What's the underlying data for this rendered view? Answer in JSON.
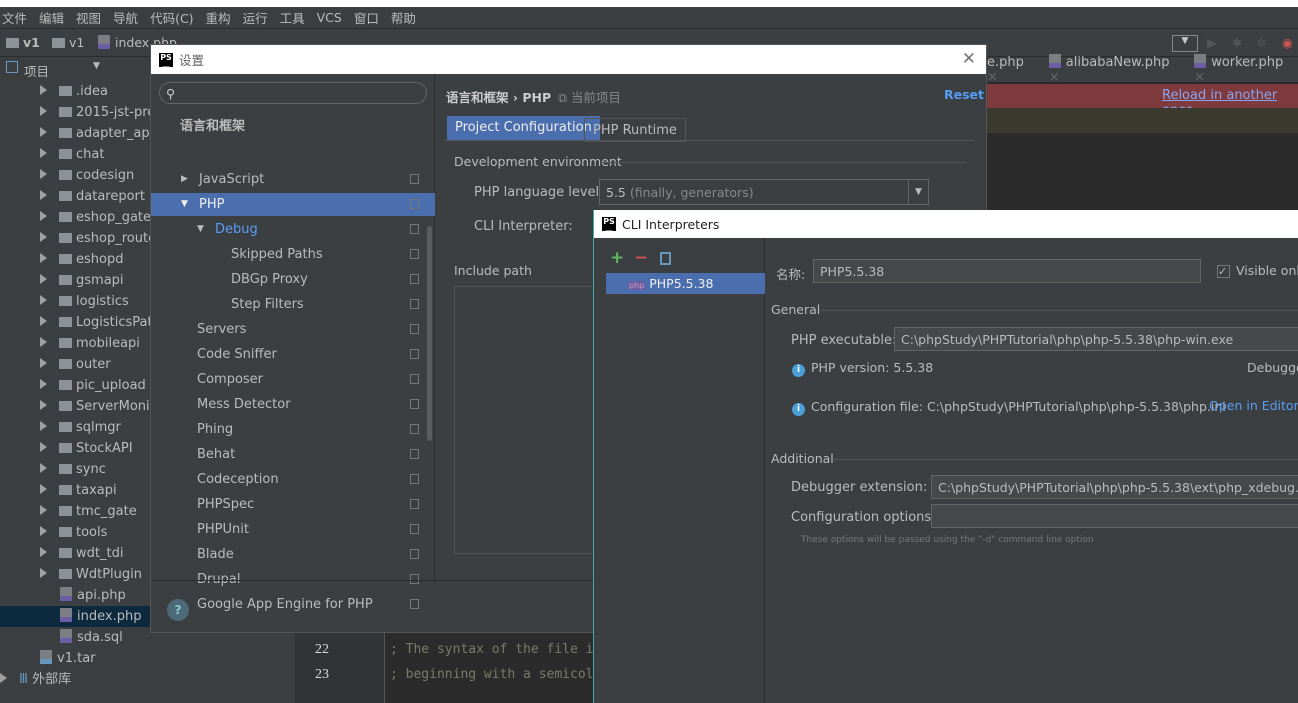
{
  "menu": [
    "文件",
    "编辑",
    "视图",
    "导航",
    "代码(C)",
    "重构",
    "运行",
    "工具",
    "VCS",
    "窗口",
    "帮助"
  ],
  "breadcrumb": [
    "v1",
    "v1",
    "index.php"
  ],
  "project_panel": {
    "title": "项目"
  },
  "tree": {
    "folders": [
      ".idea",
      "2015-jst-pre",
      "adapter_api",
      "chat",
      "codesign",
      "datareport",
      "eshop_gate",
      "eshop_route",
      "eshopd",
      "gsmapi",
      "logistics",
      "LogisticsPath",
      "mobileapi",
      "outer",
      "pic_upload",
      "ServerMonito",
      "sqlmgr",
      "StockAPI",
      "sync",
      "taxapi",
      "tmc_gate",
      "tools",
      "wdt_tdi",
      "WdtPlugin"
    ],
    "files": [
      "api.php",
      "index.php",
      "sda.sql"
    ],
    "selected": "index.php",
    "archive": "v1.tar",
    "external": "外部库"
  },
  "editor": {
    "tabs": [
      "e.php",
      "alibabaNew.php",
      "worker.php"
    ],
    "banner_link": "Reload in another enco",
    "lines": [
      {
        "num": "22",
        "text": "; The syntax of the file i"
      },
      {
        "num": "23",
        "text": "; beginning with a semicol"
      }
    ]
  },
  "settings": {
    "title": "设置",
    "search_placeholder": "",
    "section": "语言和框架",
    "items": [
      {
        "label": "JavaScript",
        "level": 0,
        "arrow": "collapsed"
      },
      {
        "label": "PHP",
        "level": 0,
        "arrow": "expanded",
        "selected": true
      },
      {
        "label": "Debug",
        "level": 1,
        "arrow": "expanded"
      },
      {
        "label": "Skipped Paths",
        "level": 2
      },
      {
        "label": "DBGp Proxy",
        "level": 2
      },
      {
        "label": "Step Filters",
        "level": 2
      },
      {
        "label": "Servers",
        "level": 1
      },
      {
        "label": "Code Sniffer",
        "level": 1
      },
      {
        "label": "Composer",
        "level": 1
      },
      {
        "label": "Mess Detector",
        "level": 1
      },
      {
        "label": "Phing",
        "level": 1
      },
      {
        "label": "Behat",
        "level": 1
      },
      {
        "label": "Codeception",
        "level": 1
      },
      {
        "label": "PHPSpec",
        "level": 1
      },
      {
        "label": "PHPUnit",
        "level": 1
      },
      {
        "label": "Blade",
        "level": 1
      },
      {
        "label": "Drupal",
        "level": 1
      },
      {
        "label": "Google App Engine for PHP",
        "level": 1
      }
    ],
    "crumb": "语言和框架 › PHP",
    "scope": "当前项目",
    "reset": "Reset",
    "tabs": [
      "Project Configuration",
      "PHP Runtime"
    ],
    "dev_env": "Development environment",
    "lang_level_label": "PHP language level:",
    "lang_level_value": "5.5",
    "lang_level_hint": "(finally, generators)",
    "cli_label": "CLI Interpreter:",
    "include_path": "Include path",
    "help": "?"
  },
  "cli": {
    "title": "CLI Interpreters",
    "list": [
      "PHP5.5.38"
    ],
    "name_label": "名称:",
    "name_value": "PHP5.5.38",
    "visible_only": "Visible onl",
    "general": "General",
    "exe_label": "PHP executable:",
    "exe_value": "C:\\phpStudy\\PHPTutorial\\php\\php-5.5.38\\php-win.exe",
    "version": "PHP version: 5.5.38",
    "debugger": "Debugge",
    "config_file": "Configuration file: C:\\phpStudy\\PHPTutorial\\php\\php-5.5.38\\php.ini",
    "open_editor": "Open in Editor",
    "additional": "Additional",
    "dbg_ext_label": "Debugger extension:",
    "dbg_ext_value": "C:\\phpStudy\\PHPTutorial\\php\\php-5.5.38\\ext\\php_xdebug.dll",
    "cfg_opts_label": "Configuration options:",
    "cfg_opts_value": "",
    "hint": "These options will be passed using the \"-d\" command line option"
  }
}
